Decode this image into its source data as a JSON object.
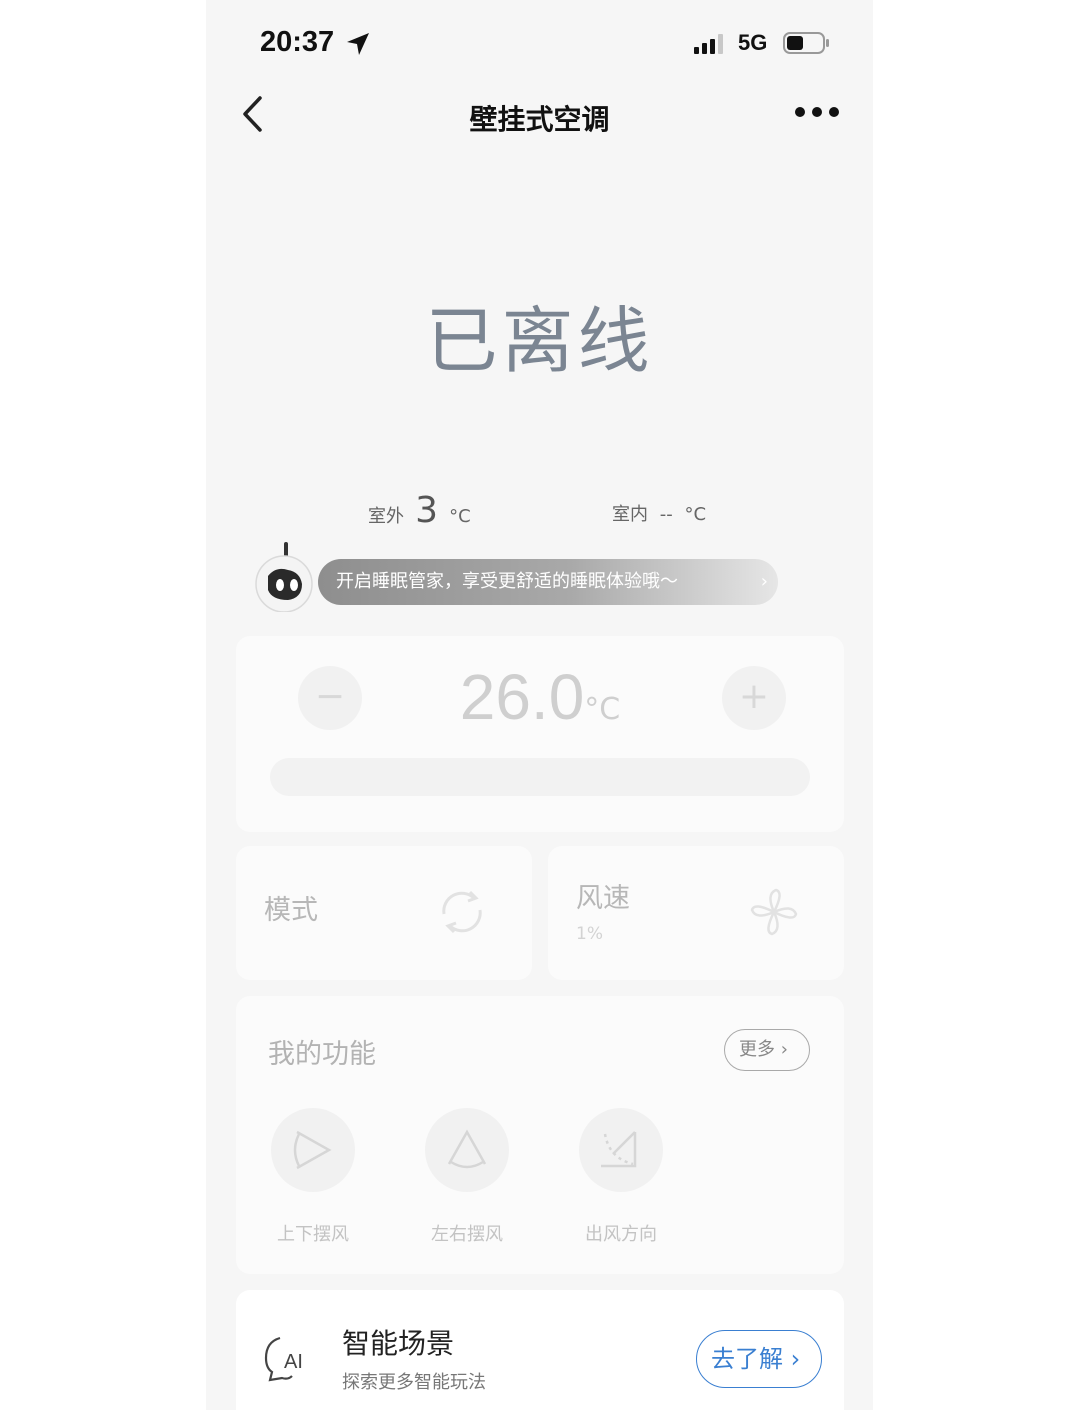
{
  "status_bar": {
    "time": "20:37",
    "network": "5G"
  },
  "nav": {
    "title": "壁挂式空调"
  },
  "device": {
    "status_text": "已离线"
  },
  "temperatures": {
    "outdoor_label": "室外",
    "outdoor_value": "3",
    "outdoor_unit": "°C",
    "indoor_label": "室内",
    "indoor_value": "--",
    "indoor_unit": "°C"
  },
  "sleep_banner": {
    "text": "开启睡眠管家，享受更舒适的睡眠体验哦～",
    "chevron": "›"
  },
  "setpoint": {
    "minus": "−",
    "plus": "+",
    "value": "26.0",
    "unit": "°C"
  },
  "mode_card": {
    "label": "模式"
  },
  "speed_card": {
    "label": "风速",
    "value": "1%"
  },
  "functions": {
    "title": "我的功能",
    "more_label": "更多",
    "items": [
      {
        "label": "上下摆风",
        "icon": "vertical-swing-icon"
      },
      {
        "label": "左右摆风",
        "icon": "horizontal-swing-icon"
      },
      {
        "label": "出风方向",
        "icon": "airflow-direction-icon"
      }
    ]
  },
  "scene": {
    "title": "智能场景",
    "subtitle": "探索更多智能玩法",
    "button_label": "去了解"
  },
  "colors": {
    "accent": "#3a7fd1",
    "status_text": "#7b8592",
    "background": "#f6f6f6"
  }
}
